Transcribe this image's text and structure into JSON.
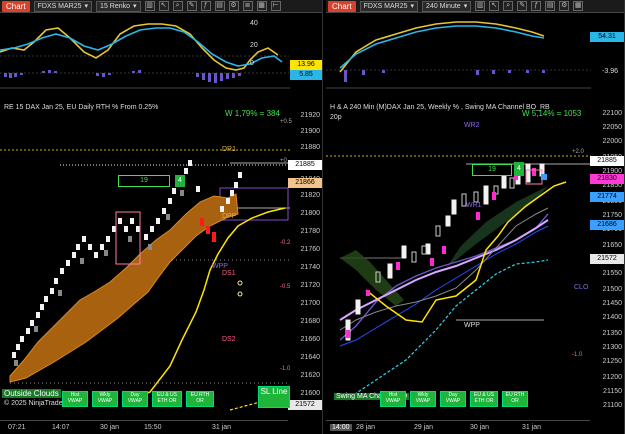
{
  "left": {
    "toolbar": {
      "chart_tab": "Chart",
      "instrument": "FDXS MAR25",
      "period": "15 Renko"
    },
    "top_axis": [
      "40",
      "20",
      "0"
    ],
    "top_tags": [
      "13.96",
      "5.85"
    ],
    "header": "RE 15 DAX Jan 25, EU Daily RTH % From 0.25%",
    "stat": "W 1,79% = 384",
    "axis": [
      "21920",
      "21900",
      "21880",
      "21860",
      "21840",
      "21820",
      "21800",
      "21780",
      "21760",
      "21740",
      "21720",
      "21700",
      "21680",
      "21660",
      "21640",
      "21620",
      "21600",
      "21580"
    ],
    "pct_labels": [
      "+0.5",
      "+0",
      "-0.2",
      "-0.5",
      "-1.0"
    ],
    "level_labels": [
      "DR1",
      "DPP",
      "WPP",
      "DS1",
      "DS2"
    ],
    "counter_box": "19",
    "counter_badge": "4",
    "price_tags": [
      {
        "text": "21885",
        "color": "#ffffff"
      },
      {
        "text": "21866",
        "color": "#f2c38a"
      },
      {
        "text": "21572",
        "color": "#e8e8e8"
      }
    ],
    "bottom_labels": [
      "Outside Clouds",
      "© 2025 NinjaTrader, LLC"
    ],
    "buttons": [
      "Hist VWAP",
      "Wkly VWAP",
      "Day VWAP",
      "EU & US ETH OR",
      "EU RTH OR"
    ],
    "sl_button": "SL Line",
    "xaxis": [
      "07:21",
      "14:07",
      "30 jan",
      "15:50",
      "31 jan"
    ]
  },
  "right": {
    "toolbar": {
      "chart_tab": "Chart",
      "instrument": "FDXS MAR25",
      "period": "240 Minute"
    },
    "top_tags": [
      "54.31",
      "-3.96"
    ],
    "header": "H & A 240 Min (M)DAX Jan 25, Weekly % , Swing MA Channel BO_RB",
    "header2": "20p",
    "stat": "W 5,14% = 1053",
    "axis": [
      "22100",
      "22050",
      "22000",
      "21950",
      "21900",
      "21850",
      "21800",
      "21750",
      "21700",
      "21650",
      "21600",
      "21550",
      "21500",
      "21450",
      "21400",
      "21350",
      "21300",
      "21250",
      "21200",
      "21150",
      "21100"
    ],
    "pct_labels": [
      "+2.0",
      "-1.0"
    ],
    "level_labels": [
      "WR2",
      "WR1",
      "WPP",
      "CLO"
    ],
    "counter_box": "19",
    "counter_badge": "4",
    "price_tags": [
      {
        "text": "21885",
        "color": "#ffffff"
      },
      {
        "text": "21830",
        "color": "#ff3ad6"
      },
      {
        "text": "21774",
        "color": "#3aa0ff"
      },
      {
        "text": "21686",
        "color": "#3aa0ff"
      },
      {
        "text": "21572",
        "color": "#e8e8e8"
      }
    ],
    "bottom_labels": [
      "Swing MA Channel BO"
    ],
    "buttons": [
      "Hist VWAP",
      "Wkly VWAP",
      "Day VWAP",
      "EU & US ETH OR",
      "EU RTH OR"
    ],
    "xaxis": [
      "14:00",
      "28 jan",
      "29 jan",
      "30 jan",
      "31 jan"
    ]
  }
}
